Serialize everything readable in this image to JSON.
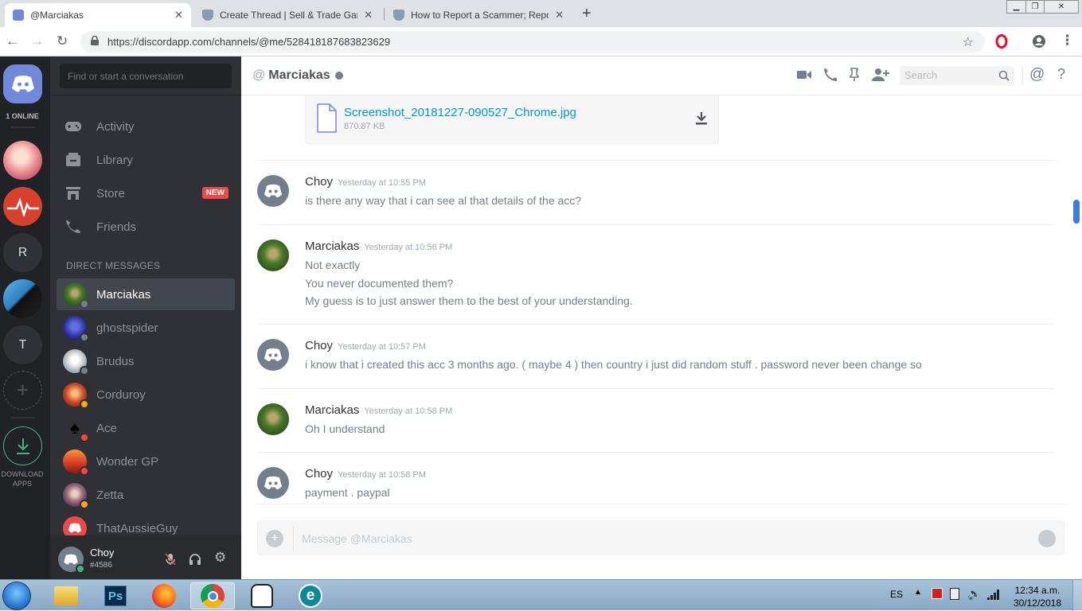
{
  "browser": {
    "tabs": [
      {
        "title": "@Marciakas",
        "active": true
      },
      {
        "title": "Create Thread | Sell & Trade Gam",
        "active": false
      },
      {
        "title": "How to Report a Scammer; Repo",
        "active": false
      }
    ],
    "url": "https://discordapp.com/channels/@me/528418187683823629"
  },
  "guilds": {
    "online_label": "1 ONLINE",
    "letters": [
      "R",
      "T"
    ],
    "download_label": "DOWNLOAD APPS"
  },
  "channels": {
    "search_placeholder": "Find or start a conversation",
    "nav": [
      {
        "label": "Activity",
        "icon": "gamepad-icon"
      },
      {
        "label": "Library",
        "icon": "library-icon"
      },
      {
        "label": "Store",
        "icon": "store-icon",
        "badge": "NEW"
      },
      {
        "label": "Friends",
        "icon": "friends-icon"
      }
    ],
    "dm_header": "DIRECT MESSAGES",
    "dms": [
      {
        "name": "Marciakas",
        "selected": true,
        "status": "offline"
      },
      {
        "name": "ghostspider",
        "selected": false,
        "status": "offline"
      },
      {
        "name": "Brudus",
        "selected": false,
        "status": "offline"
      },
      {
        "name": "Corduroy",
        "selected": false,
        "status": "idle"
      },
      {
        "name": "Ace",
        "selected": false,
        "status": "dnd"
      },
      {
        "name": "Wonder GP",
        "selected": false,
        "status": "dnd"
      },
      {
        "name": "Zetta",
        "selected": false,
        "status": "idle"
      },
      {
        "name": "ThatAussieGuy",
        "selected": false,
        "status": "offline"
      }
    ],
    "user": {
      "name": "Choy",
      "tag": "#4586"
    }
  },
  "chat": {
    "at": "@",
    "title": "Marciakas",
    "search_placeholder": "Search",
    "attachment": {
      "filename": "Screenshot_20181227-090527_Chrome.jpg",
      "size": "870.87 KB"
    },
    "messages": [
      {
        "author": "Choy",
        "time": "Yesterday at 10:55 PM",
        "lines": [
          "is there any way that i can see al that details of the acc?"
        ]
      },
      {
        "author": "Marciakas",
        "time": "Yesterday at 10:56 PM",
        "lines": [
          "Not exactly",
          "You never documented them?",
          "My guess is to just answer them to the best of your understanding."
        ]
      },
      {
        "author": "Choy",
        "time": "Yesterday at 10:57 PM",
        "lines": [
          "i know that i created this acc 3 months ago. ( maybe 4 ) then country i just did random stuff . password never been change so"
        ]
      },
      {
        "author": "Marciakas",
        "time": "Yesterday at 10:58 PM",
        "lines": [
          "Oh I understand"
        ]
      },
      {
        "author": "Choy",
        "time": "Yesterday at 10:58 PM",
        "lines": [
          "payment . paypal"
        ]
      }
    ],
    "composer_placeholder": "Message @Marciakas"
  },
  "taskbar": {
    "lang": "ES",
    "time": "12:34 a.m.",
    "date": "30/12/2018",
    "apps": [
      "explorer",
      "photoshop",
      "firefox",
      "chrome",
      "app",
      "eset"
    ]
  },
  "colors": {
    "blurple": "#7289da",
    "online": "#43b581",
    "idle": "#faa61a",
    "dnd": "#f04747",
    "offline": "#747f8d",
    "link": "#0096cf"
  }
}
